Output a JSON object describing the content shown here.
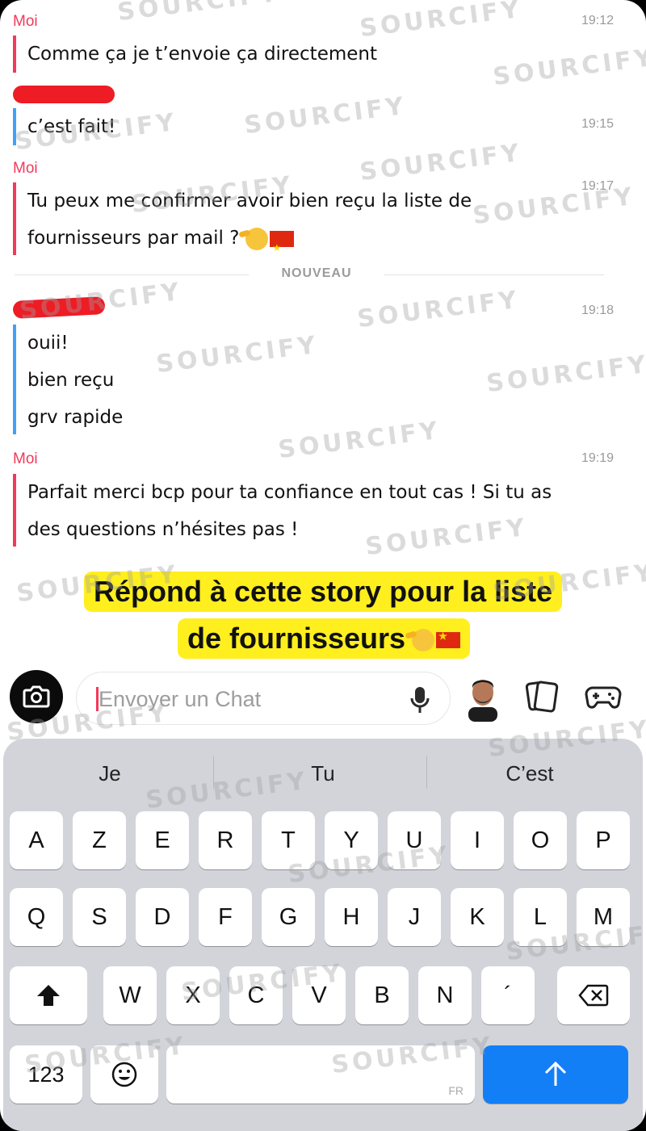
{
  "conversation": {
    "messages": [
      {
        "sender": "Moi",
        "time": "19:12",
        "lines": [
          "Comme ça je t’envoie ça directement"
        ]
      },
      {
        "sender": "",
        "time": "19:15",
        "lines": [
          "c’est fait!"
        ]
      },
      {
        "sender": "Moi",
        "time": "19:17",
        "lines": [
          "Tu peux me confirmer avoir bien reçu la liste de",
          "fournisseurs par mail ?"
        ]
      },
      {
        "sender": "",
        "time": "19:18",
        "lines": [
          "ouii!",
          "bien reçu",
          "grv rapide"
        ]
      },
      {
        "sender": "Moi",
        "time": "19:19",
        "lines": [
          "Parfait merci bcp pour ta confiance en tout cas ! Si tu as",
          "des questions n’hésites pas !"
        ]
      }
    ],
    "new_divider": "NOUVEAU"
  },
  "story_banner": {
    "line1": "Répond à cette story pour la liste",
    "line2": "de fournisseurs"
  },
  "watermark": "SOURCIFY",
  "composer": {
    "placeholder": "Envoyer un Chat"
  },
  "keyboard": {
    "suggestions": [
      "Je",
      "Tu",
      "C’est"
    ],
    "row1": [
      "A",
      "Z",
      "E",
      "R",
      "T",
      "Y",
      "U",
      "I",
      "O",
      "P"
    ],
    "row2": [
      "Q",
      "S",
      "D",
      "F",
      "G",
      "H",
      "J",
      "K",
      "L",
      "M"
    ],
    "row3": [
      "W",
      "X",
      "C",
      "V",
      "B",
      "N",
      "´"
    ],
    "numbers_key": "123",
    "space_lang": "FR"
  },
  "colors": {
    "me_accent": "#f2395a",
    "them_accent": "#3fa2f7",
    "banner_bg": "#ffef1e",
    "send_key": "#137ff7",
    "redaction": "#ee1c25"
  },
  "icons": [
    "camera-icon",
    "microphone-icon",
    "bitmoji-avatar",
    "cards-icon",
    "game-controller-icon",
    "shift-icon",
    "backspace-icon",
    "emoji-icon",
    "send-arrow-icon",
    "salute-emoji",
    "china-flag-emoji"
  ]
}
